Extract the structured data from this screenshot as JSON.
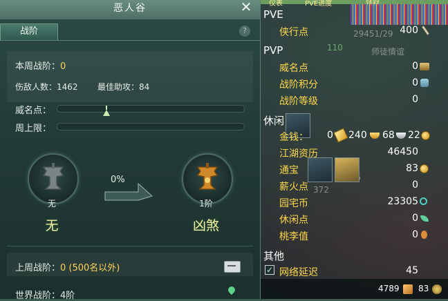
{
  "window": {
    "title": "恶人谷"
  },
  "tabs": {
    "active": "战阶"
  },
  "help": {
    "glyph": "?"
  },
  "weekly": {
    "label": "本周战阶：",
    "value": "0",
    "kills_label": "伤敌人数：",
    "kills_value": "1462",
    "assist_label": "最佳助攻：",
    "assist_value": "84",
    "prestige_label": "威名点：",
    "cap_label": "周上限："
  },
  "ranks": {
    "current_caption": "无",
    "current_name": "无",
    "progress": "0%",
    "next_caption": "1阶",
    "next_name": "凶煞"
  },
  "last_week": {
    "label": "上周战阶：",
    "value": "0 (500名以外)"
  },
  "world": {
    "label": "世界战阶：",
    "value": "4阶"
  },
  "stats": {
    "top_strip": [
      "仪表",
      "PVE进度",
      "钱财"
    ],
    "ghost": [
      "29451/29",
      "110",
      "师徒情谊",
      "372",
      "15"
    ],
    "pve_head": "PVE",
    "pve_items": [
      {
        "label": "侠行点",
        "value": "400"
      }
    ],
    "pvp_head": "PVP",
    "pvp_items": [
      {
        "label": "威名点",
        "value": "0"
      },
      {
        "label": "战阶积分",
        "value": "0"
      },
      {
        "label": "战阶等级",
        "value": "0"
      }
    ],
    "leisure_head": "休闲",
    "money": {
      "label": "金钱：",
      "a": "0",
      "b": "240",
      "c": "68",
      "d": "22"
    },
    "leisure_items": [
      {
        "label": "江湖资历",
        "value": "46450"
      },
      {
        "label": "通宝",
        "value": "83"
      },
      {
        "label": "薪火点",
        "value": "0"
      },
      {
        "label": "园宅币",
        "value": "23305"
      },
      {
        "label": "休闲点",
        "value": "0"
      },
      {
        "label": "桃李值",
        "value": "0"
      }
    ],
    "other_head": "其他",
    "latency_label": "网络延迟",
    "latency_value": "45",
    "checkbox_mark": "✓",
    "bottom_left": "4789",
    "bottom_right": "83"
  }
}
